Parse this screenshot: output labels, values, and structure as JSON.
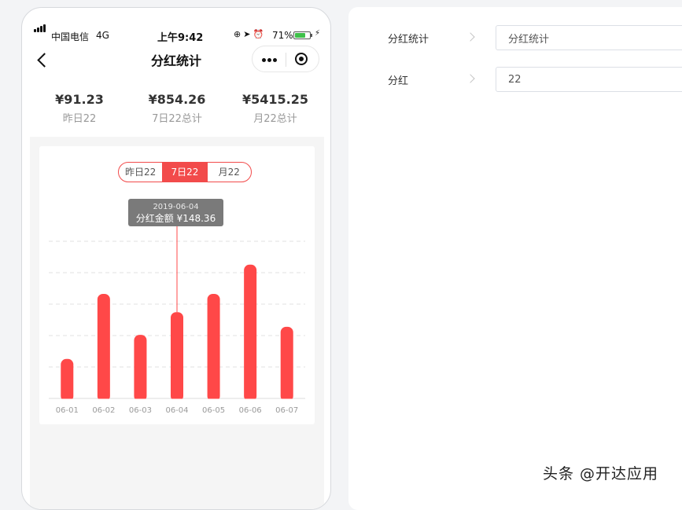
{
  "status_bar": {
    "carrier": "中国电信",
    "network": "4G",
    "time": "上午9:42",
    "battery_percent": "71%",
    "battery_level": 0.71,
    "icons": [
      "orientation-lock-icon",
      "location-icon",
      "alarm-icon"
    ]
  },
  "nav": {
    "title": "分红统计",
    "back_icon": "chevron-left-icon",
    "more_icon": "more-dots-icon",
    "close_icon": "target-icon"
  },
  "stats": [
    {
      "value": "¥91.23",
      "label": "昨日22"
    },
    {
      "value": "¥854.26",
      "label": "7日22总计"
    },
    {
      "value": "¥5415.25",
      "label": "月22总计"
    }
  ],
  "segments": [
    {
      "label": "昨日22",
      "active": false
    },
    {
      "label": "7日22",
      "active": true
    },
    {
      "label": "月22",
      "active": false
    }
  ],
  "tooltip": {
    "date": "2019-06-04",
    "text": "分红金额 ¥148.36"
  },
  "chart_data": {
    "type": "bar",
    "categories": [
      "06-01",
      "06-02",
      "06-03",
      "06-04",
      "06-05",
      "06-06",
      "06-07"
    ],
    "values": [
      54,
      143,
      87,
      118,
      143,
      183,
      98
    ],
    "highlight_index": 3,
    "ylim": [
      0,
      215
    ],
    "grid": "dashed-horizontal",
    "color": "#ff4848"
  },
  "settings": [
    {
      "label": "分红统计",
      "value": "分红统计"
    },
    {
      "label": "分红",
      "value": "22"
    }
  ],
  "watermark": "头条 @开达应用",
  "colors": {
    "accent": "#f24b4b",
    "bar": "#ff4848",
    "tooltip_bg": "#7a7a7a"
  }
}
